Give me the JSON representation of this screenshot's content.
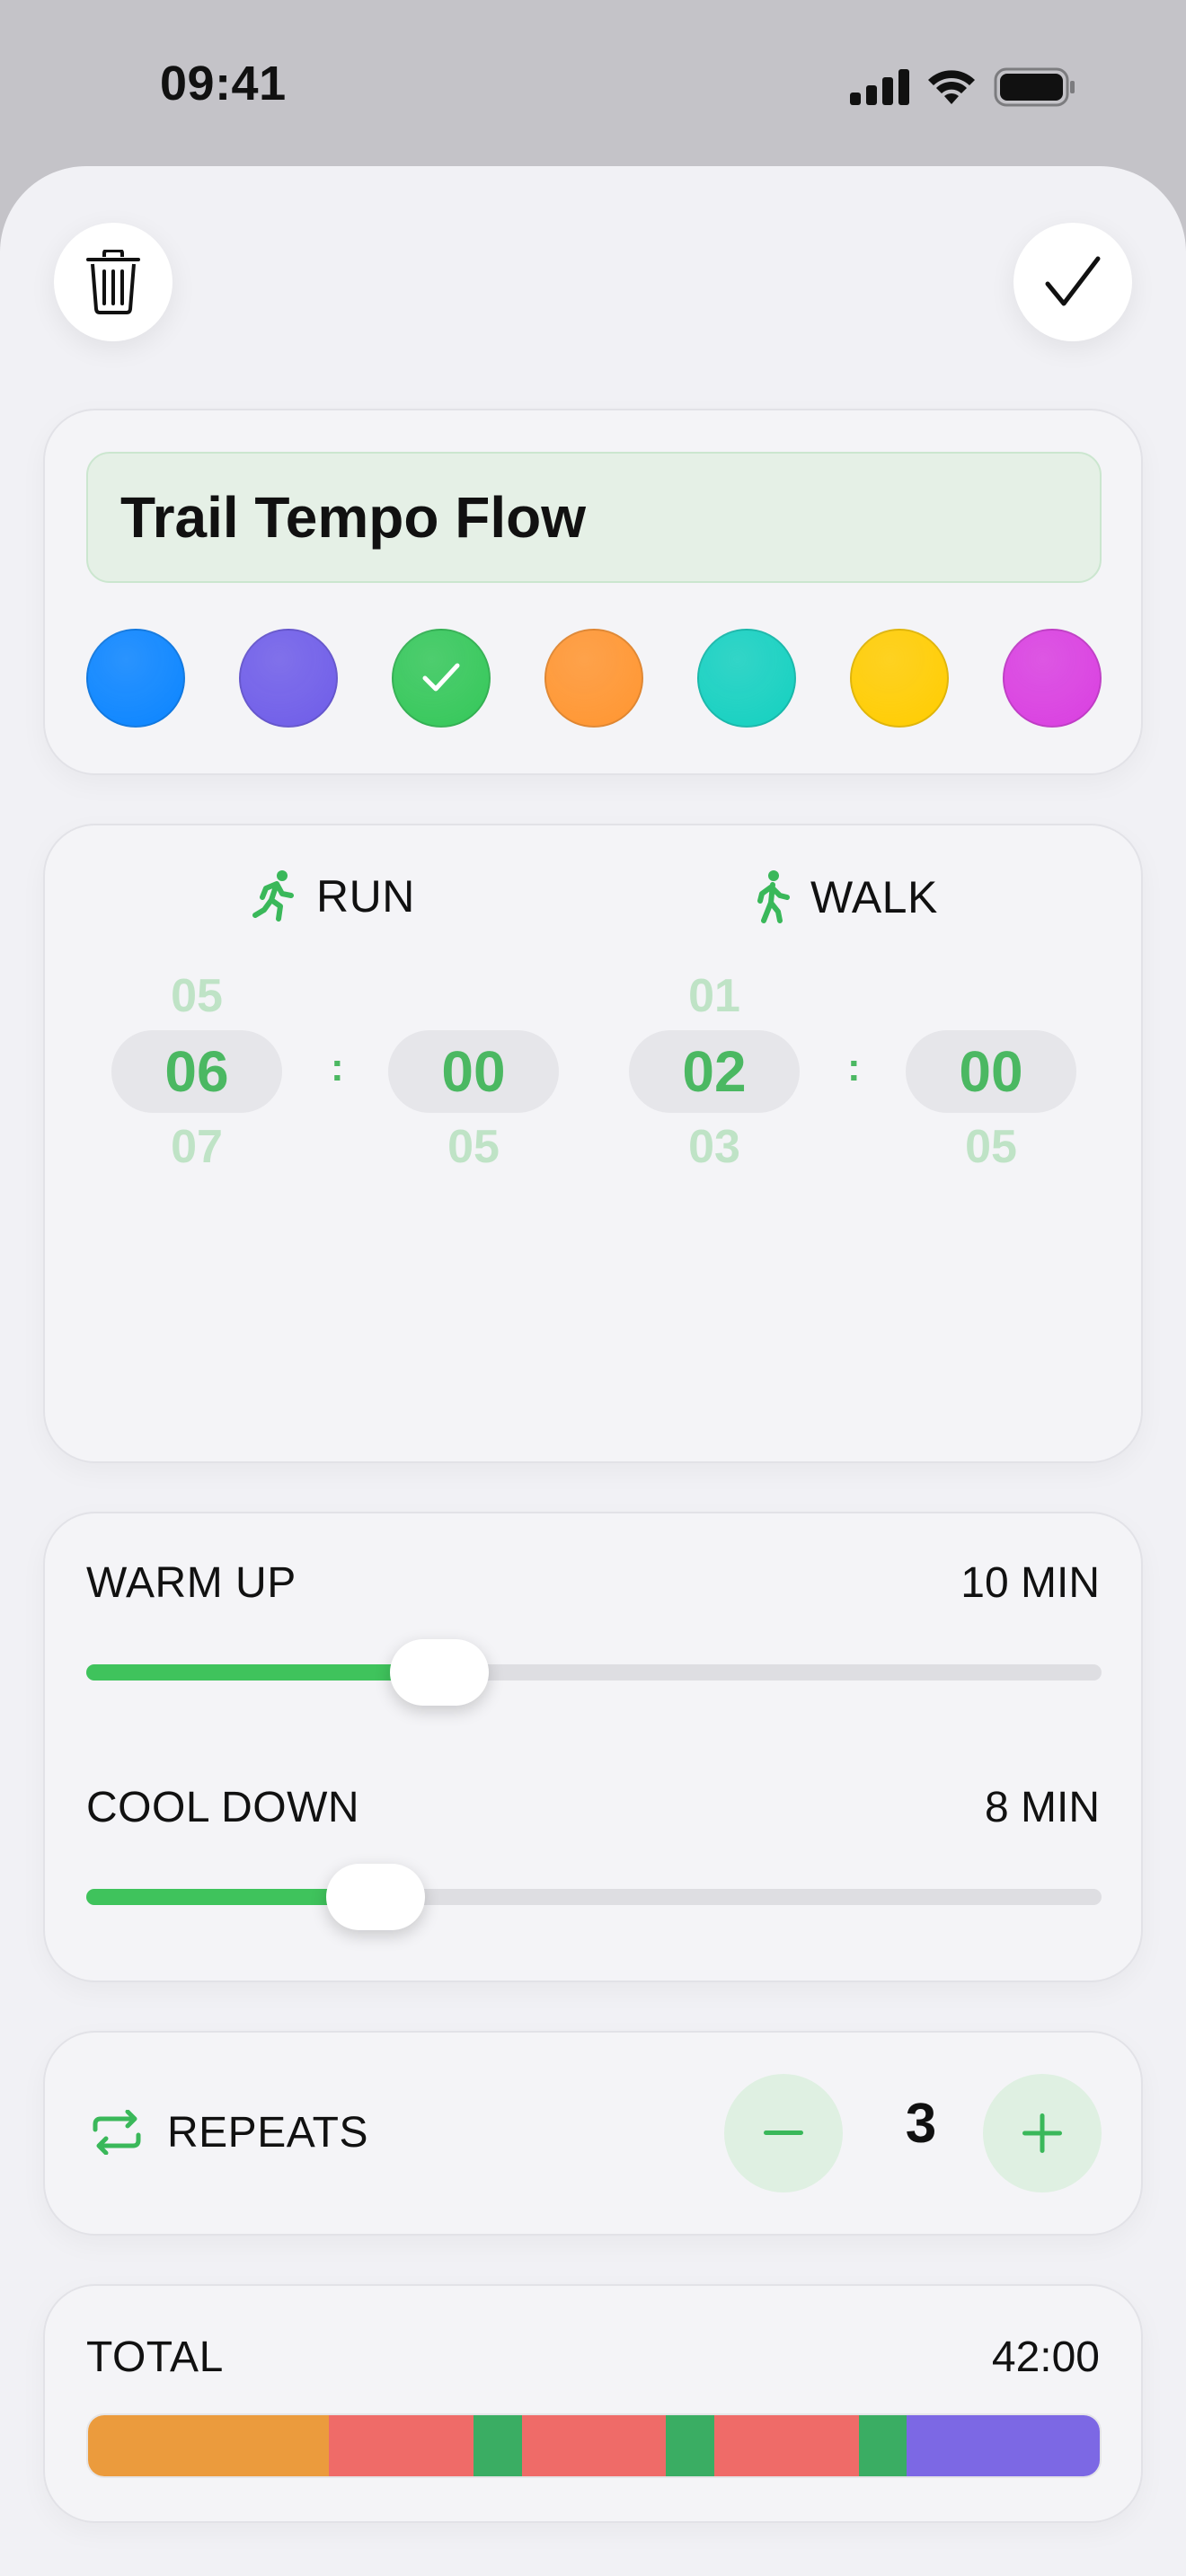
{
  "status_bar": {
    "time": "09:41"
  },
  "workout": {
    "name": "Trail Tempo Flow",
    "selected_color": "#34c759",
    "colors": [
      "#0a84ff",
      "#6e5ce8",
      "#34c759",
      "#ff9530",
      "#14d0c0",
      "#ffcc00",
      "#d93ee0"
    ]
  },
  "intervals": {
    "run": {
      "label": "RUN",
      "minutes": {
        "prev": "05",
        "value": "06",
        "next": "07"
      },
      "seconds": {
        "value": "00",
        "next": "05"
      }
    },
    "walk": {
      "label": "WALK",
      "minutes": {
        "prev": "01",
        "value": "02",
        "next": "03"
      },
      "seconds": {
        "value": "00",
        "next": "05"
      }
    },
    "separator": ":"
  },
  "warm_up": {
    "label": "WARM UP",
    "value_text": "10 MIN",
    "level": 0.348
  },
  "cool_down": {
    "label": "COOL DOWN",
    "value_text": "8 MIN",
    "level": 0.285
  },
  "repeats": {
    "label": "REPEATS",
    "count": "3"
  },
  "total": {
    "label": "TOTAL",
    "value": "42:00",
    "segments": [
      {
        "kind": "warm-up",
        "minutes": 10,
        "color": "#eb9b3d"
      },
      {
        "kind": "run",
        "minutes": 6,
        "color": "#ef6b68"
      },
      {
        "kind": "walk",
        "minutes": 2,
        "color": "#3aad63"
      },
      {
        "kind": "run",
        "minutes": 6,
        "color": "#ef6b68"
      },
      {
        "kind": "walk",
        "minutes": 2,
        "color": "#3aad63"
      },
      {
        "kind": "run",
        "minutes": 6,
        "color": "#ef6b68"
      },
      {
        "kind": "walk",
        "minutes": 2,
        "color": "#3aad63"
      },
      {
        "kind": "cool-down",
        "minutes": 8,
        "color": "#7c68e4"
      }
    ]
  },
  "accent": "#34c759"
}
